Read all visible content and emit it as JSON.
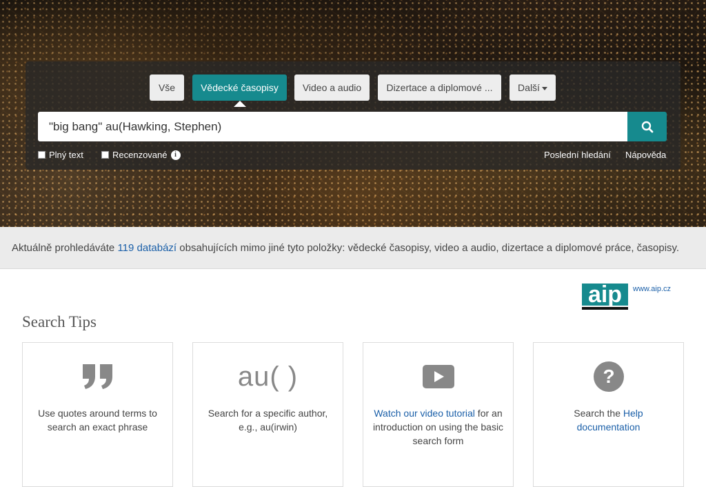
{
  "tabs": [
    {
      "label": "Vše"
    },
    {
      "label": "Vědecké časopisy"
    },
    {
      "label": "Video a audio"
    },
    {
      "label": "Dizertace a diplomové ..."
    },
    {
      "label": "Další"
    }
  ],
  "search": {
    "value": "\"big bang\" au(Hawking, Stephen)"
  },
  "options": {
    "fulltext_label": "Plný text",
    "peer_label": "Recenzované",
    "recent_label": "Poslední hledání",
    "help_label": "Nápověda"
  },
  "infobar": {
    "prefix": "Aktuálně prohledáváte ",
    "link": "119 databází",
    "suffix": " obsahujících mimo jiné tyto položky: vědecké časopisy, video a audio, dizertace a diplomové práce, časopisy."
  },
  "logo": {
    "text": "aip",
    "link": "www.aip.cz"
  },
  "tips": {
    "title": "Search Tips",
    "cards": [
      {
        "icon": "quote-icon",
        "text": "Use quotes around terms to search an exact phrase"
      },
      {
        "icon": "au-text",
        "icon_text": "au( )",
        "text": "Search for a specific author, e.g., au(irwin)"
      },
      {
        "icon": "play-video-icon",
        "link": "Watch our video tutorial",
        "text": " for an introduction on using the basic search form"
      },
      {
        "icon": "question-icon",
        "prefix": "Search the ",
        "link": "Help documentation"
      }
    ]
  },
  "colors": {
    "accent": "#168a8e",
    "link": "#1a5fa8"
  }
}
